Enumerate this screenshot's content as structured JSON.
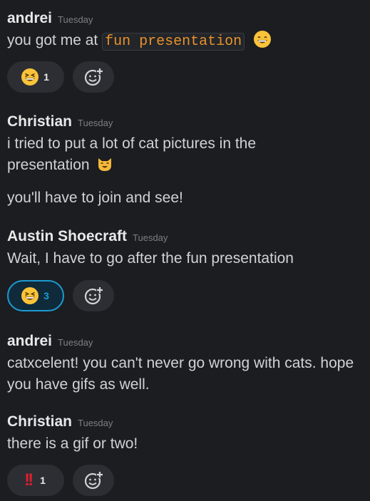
{
  "messages": [
    {
      "author": "andrei",
      "time": "Tuesday",
      "text_before": "you got me at ",
      "code": "fun presentation",
      "emoji_icon": "grinning-face-icon",
      "reaction": {
        "icon": "laughing-face-icon",
        "count": "1"
      }
    },
    {
      "author": "Christian",
      "time": "Tuesday",
      "text": "i tried to put a lot of cat pictures in the presentation",
      "emoji_icon": "smiling-cat-icon",
      "text2": "you'll have to join and see!"
    },
    {
      "author": "Austin Shoecraft",
      "time": "Tuesday",
      "text": "Wait, I have to go after the fun presentation",
      "reaction": {
        "icon": "laughing-face-icon",
        "count": "3"
      }
    },
    {
      "author": "andrei",
      "time": "Tuesday",
      "text": "catxcelent! you can't never go wrong with cats. hope you have gifs as well."
    },
    {
      "author": "Christian",
      "time": "Tuesday",
      "text": "there is a gif or two!",
      "reaction": {
        "icon": "double-exclamation-icon",
        "label": "!!",
        "count": "1"
      }
    }
  ],
  "colors": {
    "background": "#1b1d21",
    "code_text": "#e8912d",
    "active_reaction": "#1d9bd1",
    "exclamation": "#e01e2e"
  }
}
